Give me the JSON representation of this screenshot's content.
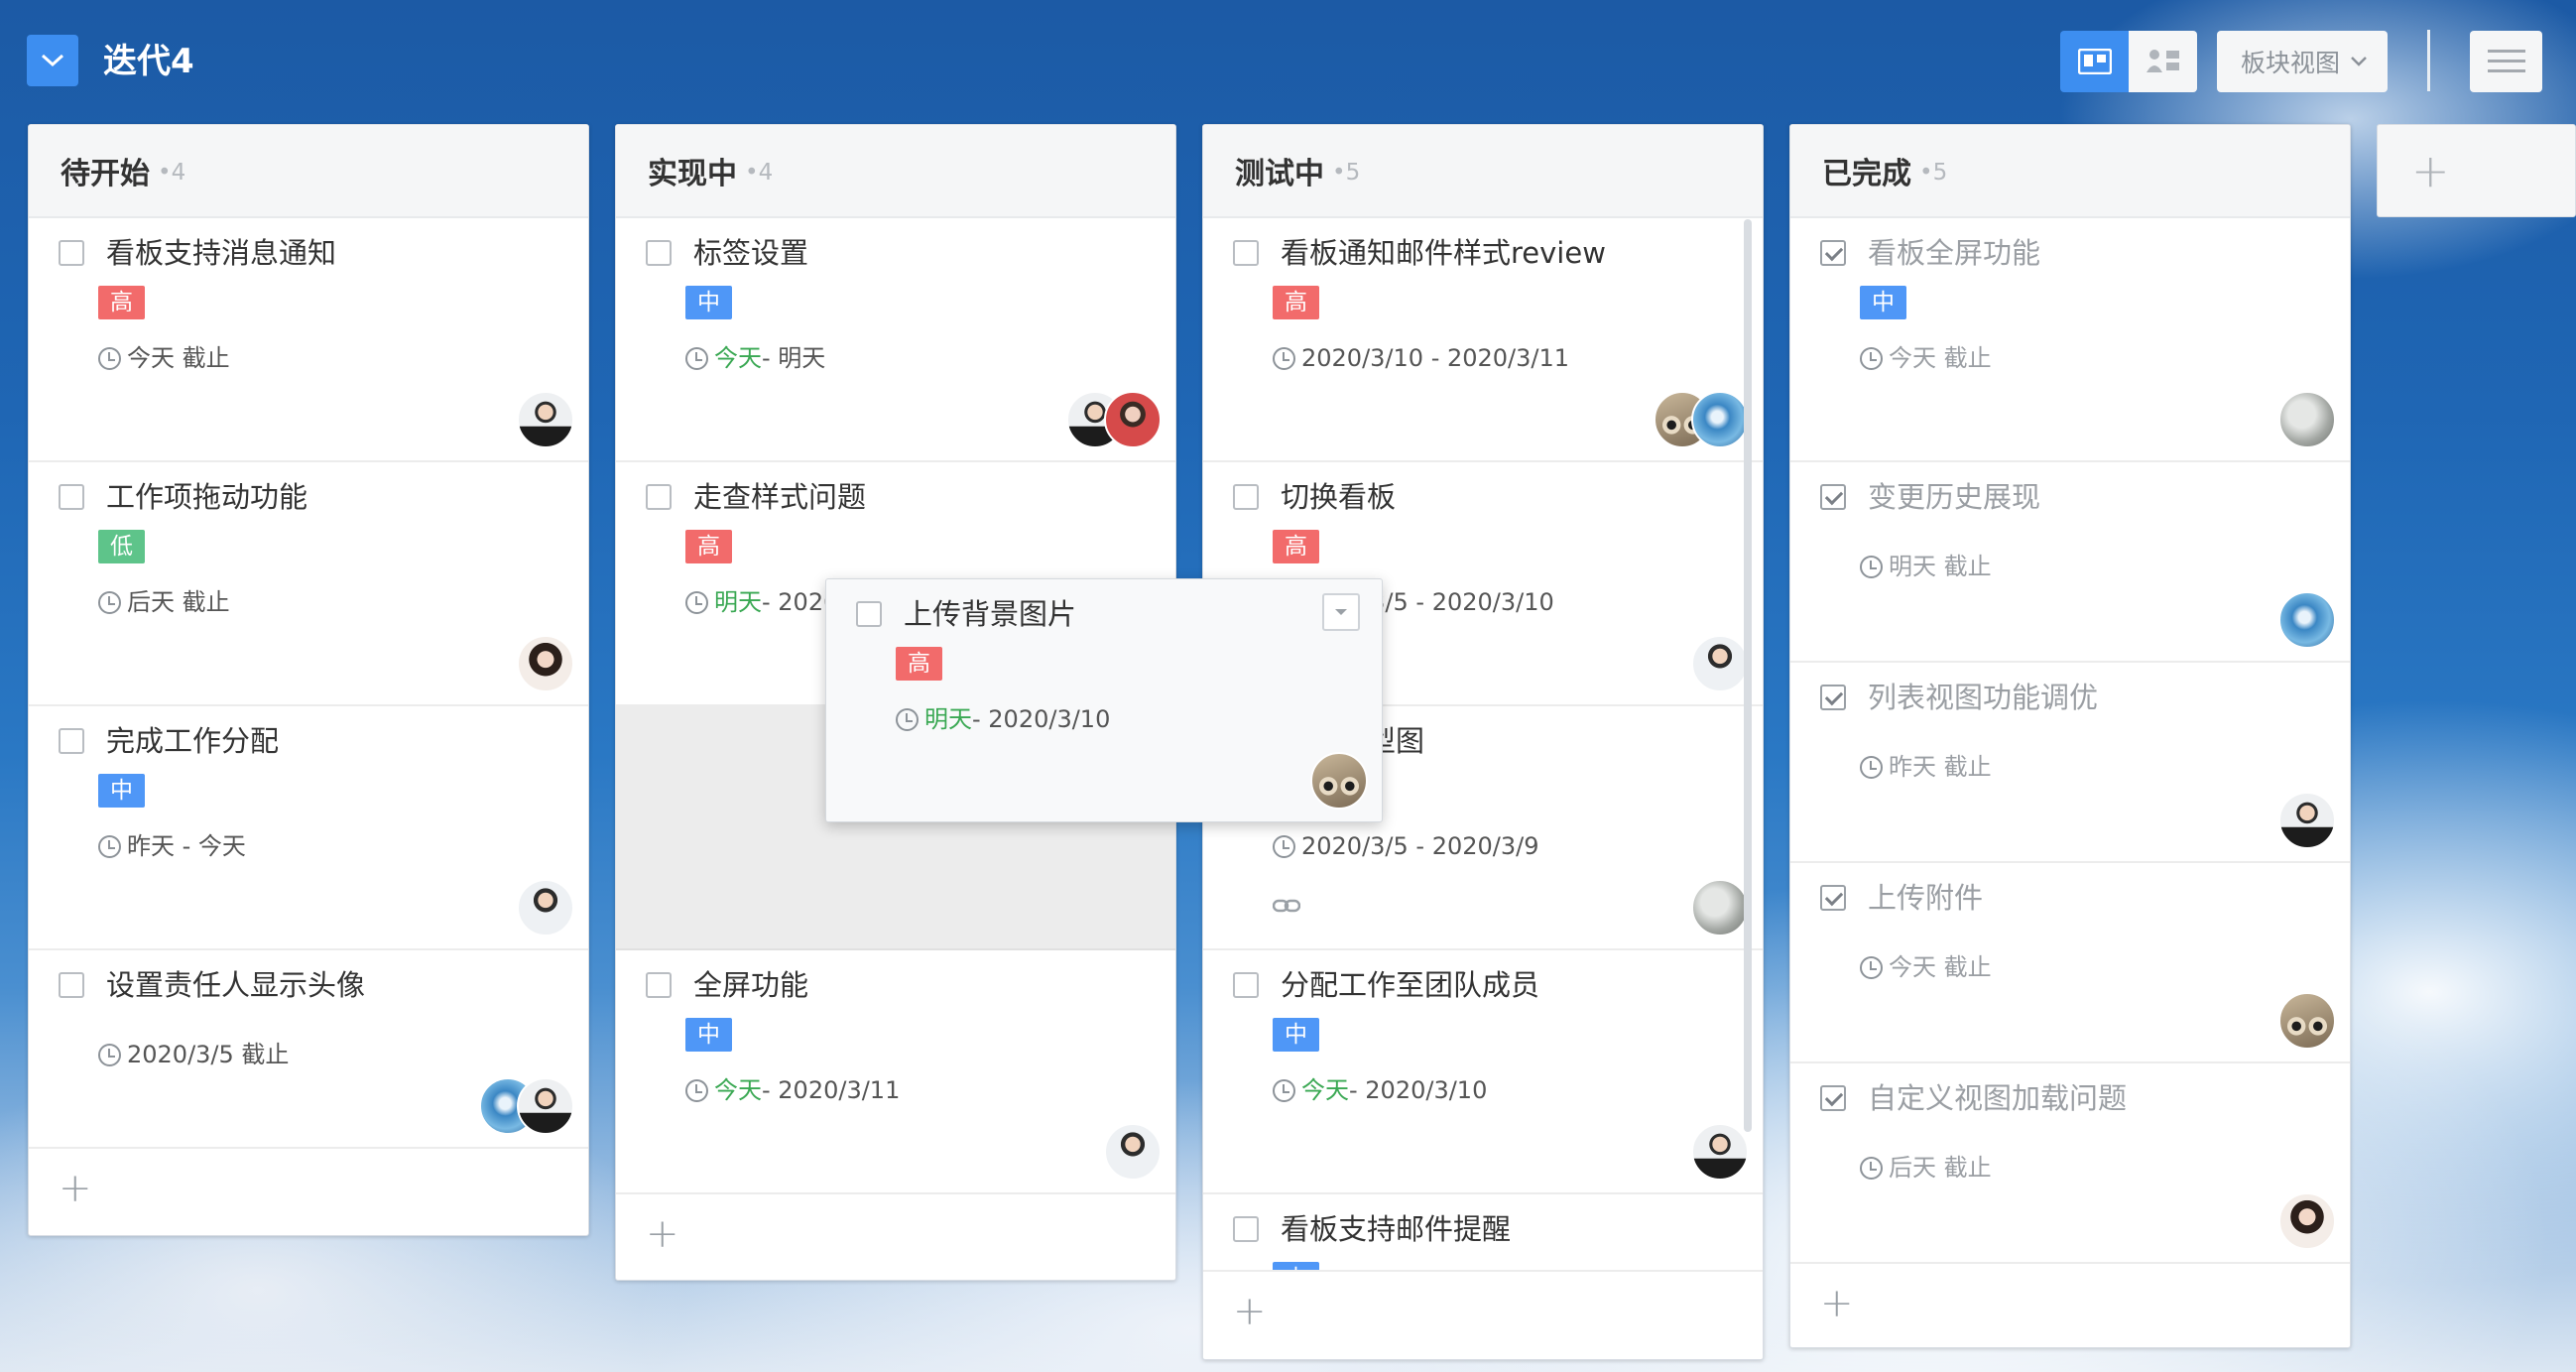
{
  "header": {
    "title": "迭代4",
    "view_select": "板块视图"
  },
  "colors": {
    "accent": "#3d8ef0",
    "high": "#f26b6b",
    "mid": "#4f97f7",
    "low": "#5ec48a",
    "today": "#3aa853"
  },
  "columns": [
    {
      "name": "待开始",
      "count": "•4",
      "cards": [
        {
          "title": "看板支持消息通知",
          "priority": "高",
          "date_hl": "",
          "date": "今天 截止"
        },
        {
          "title": "工作项拖动功能",
          "priority": "低",
          "date_hl": "",
          "date": "后天 截止"
        },
        {
          "title": "完成工作分配",
          "priority": "中",
          "date_hl": "",
          "date": "昨天 - 今天"
        },
        {
          "title": "设置责任人显示头像",
          "priority": "",
          "date_hl": "",
          "date": "2020/3/5 截止"
        }
      ]
    },
    {
      "name": "实现中",
      "count": "•4",
      "cards": [
        {
          "title": "标签设置",
          "priority": "中",
          "date_hl": "今天",
          "date": " - 明天"
        },
        {
          "title": "走查样式问题",
          "priority": "高",
          "date_hl": "明天",
          "date": " - 2020/3/11"
        },
        {
          "title": "全屏功能",
          "priority": "中",
          "date_hl": "今天",
          "date": " - 2020/3/11"
        }
      ]
    },
    {
      "name": "测试中",
      "count": "•5",
      "cards": [
        {
          "title": "看板通知邮件样式review",
          "priority": "高",
          "date_hl": "",
          "date": "2020/3/10 - 2020/3/11"
        },
        {
          "title": "切换看板",
          "priority": "高",
          "date_hl": "",
          "date": "2020/3/5 - 2020/3/10"
        },
        {
          "title": "设计原型图",
          "priority": "",
          "date_hl": "",
          "date": "2020/3/5 - 2020/3/9"
        },
        {
          "title": "分配工作至团队成员",
          "priority": "中",
          "date_hl": "今天",
          "date": " - 2020/3/10"
        },
        {
          "title": "看板支持邮件提醒",
          "priority": "中",
          "date_hl": "",
          "date": ""
        }
      ]
    },
    {
      "name": "已完成",
      "count": "•5",
      "cards": [
        {
          "title": "看板全屏功能",
          "priority": "中",
          "date_hl": "",
          "date": "今天 截止"
        },
        {
          "title": "变更历史展现",
          "priority": "",
          "date_hl": "",
          "date": "明天 截止"
        },
        {
          "title": "列表视图功能调优",
          "priority": "",
          "date_hl": "",
          "date": "昨天 截止"
        },
        {
          "title": "上传附件",
          "priority": "",
          "date_hl": "",
          "date": "今天 截止"
        },
        {
          "title": "自定义视图加载问题",
          "priority": "",
          "date_hl": "",
          "date": "后天 截止"
        }
      ]
    }
  ],
  "dragging_card": {
    "title": "上传背景图片",
    "priority": "高",
    "date_hl": "明天",
    "date": " - 2020/3/10"
  }
}
